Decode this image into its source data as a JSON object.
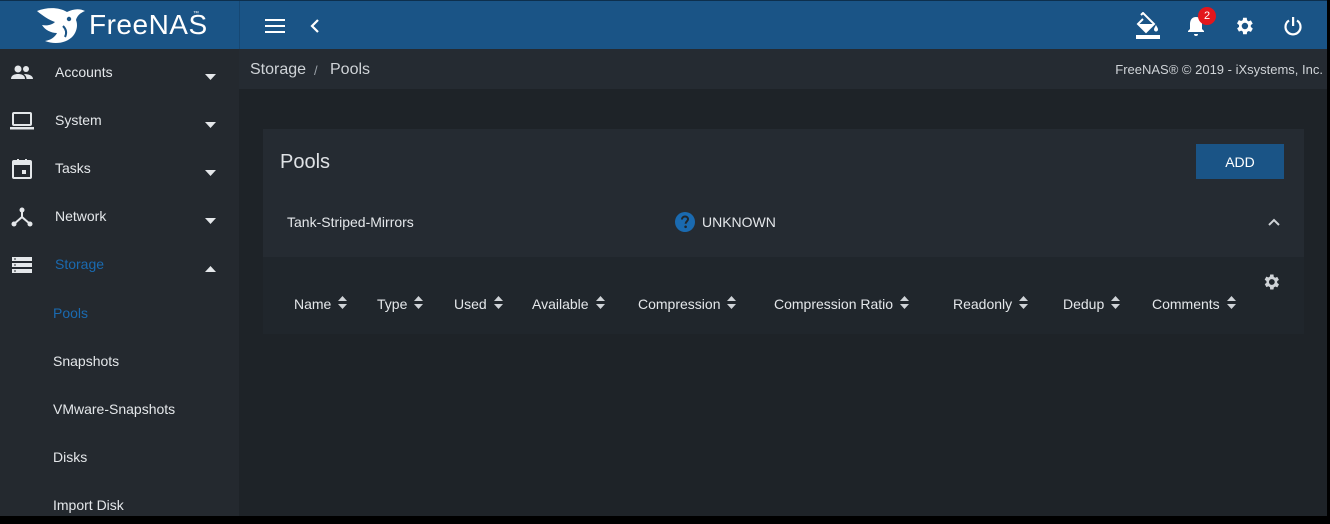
{
  "app": {
    "brand": "FreeNAS",
    "tm": "™"
  },
  "topbar": {
    "menu_icon": "menu-icon",
    "back_icon": "chevron-left-icon",
    "theme_icon": "paint-bucket-icon",
    "alerts_icon": "bell-icon",
    "alerts_count": "2",
    "settings_icon": "gear-icon",
    "power_icon": "power-icon"
  },
  "sidebar": {
    "items": [
      {
        "label": "Accounts",
        "icon": "accounts-icon"
      },
      {
        "label": "System",
        "icon": "laptop-icon"
      },
      {
        "label": "Tasks",
        "icon": "calendar-icon"
      },
      {
        "label": "Network",
        "icon": "network-icon"
      },
      {
        "label": "Storage",
        "icon": "storage-icon"
      }
    ],
    "storage_sub": [
      {
        "label": "Pools"
      },
      {
        "label": "Snapshots"
      },
      {
        "label": "VMware-Snapshots"
      },
      {
        "label": "Disks"
      },
      {
        "label": "Import Disk"
      }
    ]
  },
  "breadcrumb": {
    "section": "Storage",
    "separator": "/",
    "page": "Pools"
  },
  "copyright": "FreeNAS® © 2019 - iXsystems, Inc.",
  "card": {
    "title": "Pools",
    "add_label": "ADD",
    "pool": {
      "name": "Tank-Striped-Mirrors",
      "status": "UNKNOWN"
    },
    "columns": [
      "Name",
      "Type",
      "Used",
      "Available",
      "Compression",
      "Compression Ratio",
      "Readonly",
      "Dedup",
      "Comments"
    ]
  },
  "colors": {
    "accent": "#1a5486",
    "active": "#1a6ab0",
    "background": "#1e2328",
    "sidebar": "#24292f",
    "card": "#252b32"
  }
}
